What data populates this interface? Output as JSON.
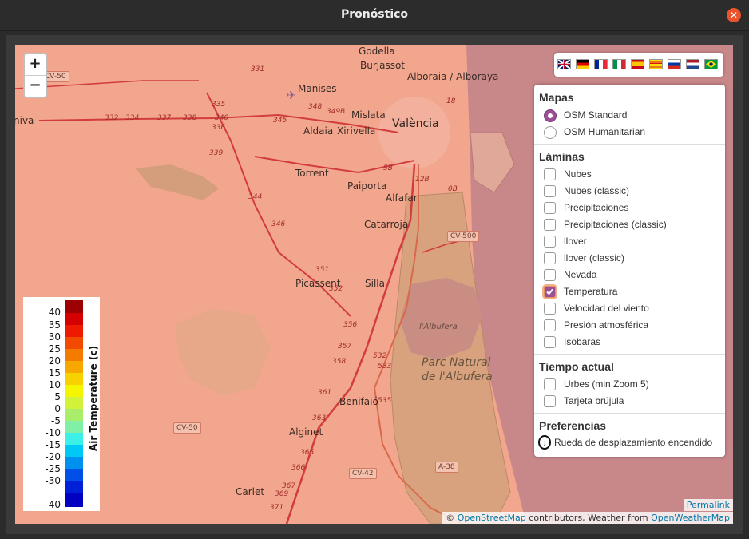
{
  "window": {
    "title": "Pronóstico"
  },
  "map": {
    "labels": {
      "valencia": "València",
      "manises": "Manises",
      "mislata": "Mislata",
      "aldaia": "Aldaia",
      "xirivella": "Xirivella",
      "torrent": "Torrent",
      "paiporta": "Paiporta",
      "alfafar": "Alfafar",
      "catarroja": "Catarroja",
      "picassent": "Picassent",
      "silla": "Silla",
      "alginet": "Alginet",
      "benifaio": "Benifaió",
      "carlet": "Carlet",
      "godella": "Godella",
      "burjassot": "Burjassot",
      "alboraia": "Alboraia / Alboraya",
      "albufera_lake": "l'Albufera",
      "parc_natural_1": "Parc Natural",
      "parc_natural_2": "de l'Albufera",
      "iva": "niva"
    },
    "road_numbers": [
      "331",
      "332",
      "334",
      "335",
      "336",
      "337",
      "338",
      "339",
      "340",
      "344",
      "345",
      "346",
      "348",
      "349B",
      "351",
      "352",
      "356",
      "357",
      "358",
      "361",
      "363",
      "365",
      "366",
      "367",
      "369",
      "371",
      "5B",
      "12B",
      "0B",
      "18",
      "532",
      "533",
      "535"
    ],
    "shields": {
      "cv50_top": "CV-50",
      "cv500": "CV-500",
      "cv50_bottom": "CV-50",
      "cv42": "CV-42",
      "a38": "A-38"
    }
  },
  "zoom": {
    "in": "+",
    "out": "−"
  },
  "languages": [
    "English",
    "Deutsch",
    "Français",
    "Italiano",
    "Español",
    "Català",
    "Русский",
    "Nederlands",
    "Português"
  ],
  "panel": {
    "mapas": {
      "title": "Mapas",
      "options": [
        "OSM Standard",
        "OSM Humanitarian"
      ],
      "selected": "OSM Standard"
    },
    "laminas": {
      "title": "Láminas",
      "items": [
        {
          "label": "Nubes",
          "checked": false
        },
        {
          "label": "Nubes (classic)",
          "checked": false
        },
        {
          "label": "Precipitaciones",
          "checked": false
        },
        {
          "label": "Precipitaciones (classic)",
          "checked": false
        },
        {
          "label": "llover",
          "checked": false
        },
        {
          "label": "llover (classic)",
          "checked": false
        },
        {
          "label": "Nevada",
          "checked": false
        },
        {
          "label": "Temperatura",
          "checked": true
        },
        {
          "label": "Velocidad del viento",
          "checked": false
        },
        {
          "label": "Presión atmosférica",
          "checked": false
        },
        {
          "label": "Isobaras",
          "checked": false
        }
      ]
    },
    "tiempo": {
      "title": "Tiempo actual",
      "items": [
        {
          "label": "Urbes (min Zoom 5)",
          "checked": false
        },
        {
          "label": "Tarjeta brújula",
          "checked": false
        }
      ]
    },
    "preferencias": {
      "title": "Preferencias",
      "wheel_label": "Rueda de desplazamiento encendido"
    }
  },
  "legend": {
    "axis_label": "Air Temperature (c)",
    "values": [
      "40",
      "35",
      "30",
      "25",
      "20",
      "15",
      "10",
      "5",
      "0",
      "-5",
      "-10",
      "-15",
      "-20",
      "-25",
      "-30",
      "-40"
    ],
    "colors": [
      "#9c0000",
      "#d40000",
      "#ee1a00",
      "#f24a00",
      "#f47a00",
      "#f6a800",
      "#f8d200",
      "#f5f500",
      "#d2f23a",
      "#a8ee6a",
      "#7ff0a6",
      "#3cf0e8",
      "#00c8f5",
      "#0090f0",
      "#0050e8",
      "#0020d8",
      "#0000c0"
    ]
  },
  "attribution": {
    "prefix": "©",
    "osm": "OpenStreetMap",
    "middle": "contributors, Weather from",
    "owm": "OpenWeatherMap"
  },
  "permalink": "Permalink"
}
